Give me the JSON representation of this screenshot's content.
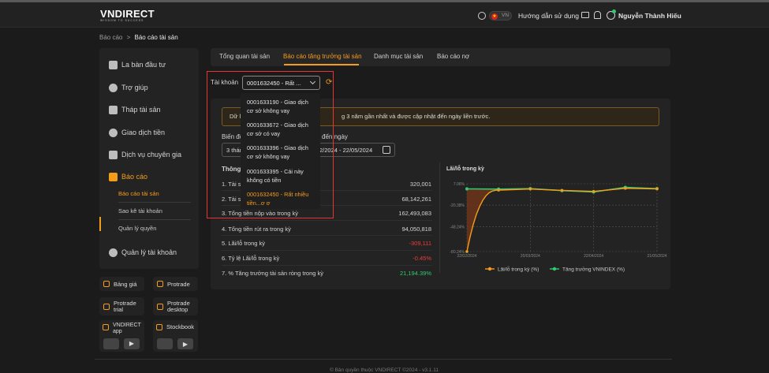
{
  "header": {
    "logo": "VNDIRECT",
    "logo_tagline": "WISDOM TO SUCCESS",
    "lang": "VN",
    "guide": "Hướng dẫn sử dụng",
    "user": "Nguyễn Thành Hiếu"
  },
  "breadcrumb": {
    "root": "Báo cáo",
    "sep": ">",
    "current": "Báo cáo tài sản"
  },
  "sidebar": {
    "items": [
      {
        "label": "La bàn đầu tư"
      },
      {
        "label": "Trợ giúp"
      },
      {
        "label": "Tháp tài sản"
      },
      {
        "label": "Giao dịch tiền"
      },
      {
        "label": "Dịch vụ chuyên gia"
      },
      {
        "label": "Báo cáo"
      },
      {
        "label": "Quản lý tài khoản"
      }
    ],
    "sub": [
      {
        "label": "Báo cáo tài sản"
      },
      {
        "label": "Sao kê tài khoản"
      },
      {
        "label": "Quản lý quyền"
      }
    ]
  },
  "tools": {
    "bang_gia": "Bảng giá",
    "protrade": "Protrade",
    "protrade_trial_1": "Protrade",
    "protrade_trial_2": "trial",
    "protrade_desktop_1": "Protrade",
    "protrade_desktop_2": "desktop",
    "vndirect_app_1": "VNDIRECT",
    "vndirect_app_2": "app",
    "stockbook": "Stockbook"
  },
  "tabs": [
    {
      "label": "Tổng quan tài sản"
    },
    {
      "label": "Báo cáo tăng trưởng tài sản"
    },
    {
      "label": "Danh mục tài sản"
    },
    {
      "label": "Báo cáo nợ"
    }
  ],
  "account": {
    "label": "Tài khoản",
    "selected": "0001632450 - Rất ...",
    "options": [
      {
        "line1": "0001633190 - Giao dịch",
        "line2": "cơ sở không vay"
      },
      {
        "line1": "0001633672 - Giao dịch",
        "line2": "cơ sở có vay"
      },
      {
        "line1": "0001633396 - Giao dịch",
        "line2": "cơ sở không vay"
      },
      {
        "line1": "0001633395 - Cái này",
        "line2": "không có tiền"
      },
      {
        "line1": "0001632450 - Rất nhiều",
        "line2": "tiền...ơ ơ"
      }
    ]
  },
  "notice": {
    "left": "Dữ liệ",
    "right": "g 3 năm gần nhất và được cập nhật đến ngày liền trước."
  },
  "filters": {
    "range_label": "Biến độ",
    "to_label": "đến ngày",
    "range_value": "3 thán",
    "date_value": "2/2024 - 22/05/2024"
  },
  "stats": {
    "title": "Thông t",
    "rows": [
      {
        "label": "1. Tài sả",
        "value": "320,001"
      },
      {
        "label": "2. Tài sả",
        "value": "68,142,261"
      },
      {
        "label": "3. Tổng tiền nộp vào trong kỳ",
        "value": "162,493,083"
      },
      {
        "label": "4. Tổng tiền rút ra trong kỳ",
        "value": "94,050,818"
      },
      {
        "label": "5. Lãi/lỗ trong kỳ",
        "value": "-309,111"
      },
      {
        "label": "6. Tỷ lệ Lãi/lỗ trong kỳ",
        "value": "-0.45%"
      },
      {
        "label": "7. % Tăng trưởng tài sản ròng trong kỳ",
        "value": "21,194.39%"
      }
    ]
  },
  "colors": {
    "accent": "#f59c1a",
    "series_pl": "#f59c1a",
    "series_vnindex": "#2fcc70",
    "negative": "#ef3b3b"
  },
  "chart_data": {
    "type": "line",
    "title": "Lãi/lỗ trong kỳ",
    "y_ticks": [
      "7.06%",
      "-20.38%",
      "-48.24%",
      "-80.24%"
    ],
    "x_ticks": [
      "22/02/2024",
      "20/03/2024",
      "22/04/2024",
      "21/05/2024"
    ],
    "ylim": [
      -80.24,
      7.06
    ],
    "series": [
      {
        "name": "Lãi/lỗ trong kỳ (%)",
        "values": [
          -80.24,
          -1.2,
          0.3,
          -1.5,
          -2.8,
          1.2,
          0.5
        ]
      },
      {
        "name": "Tăng trưởng VNINDEX (%)",
        "values": [
          0.5,
          0.2,
          0.8,
          -1.8,
          -3.5,
          2.5,
          0.8
        ]
      }
    ],
    "legend": "bottom"
  },
  "footer": {
    "text": "© Bản quyền thuộc VNDIRECT ©2024 - v3.1.11"
  }
}
